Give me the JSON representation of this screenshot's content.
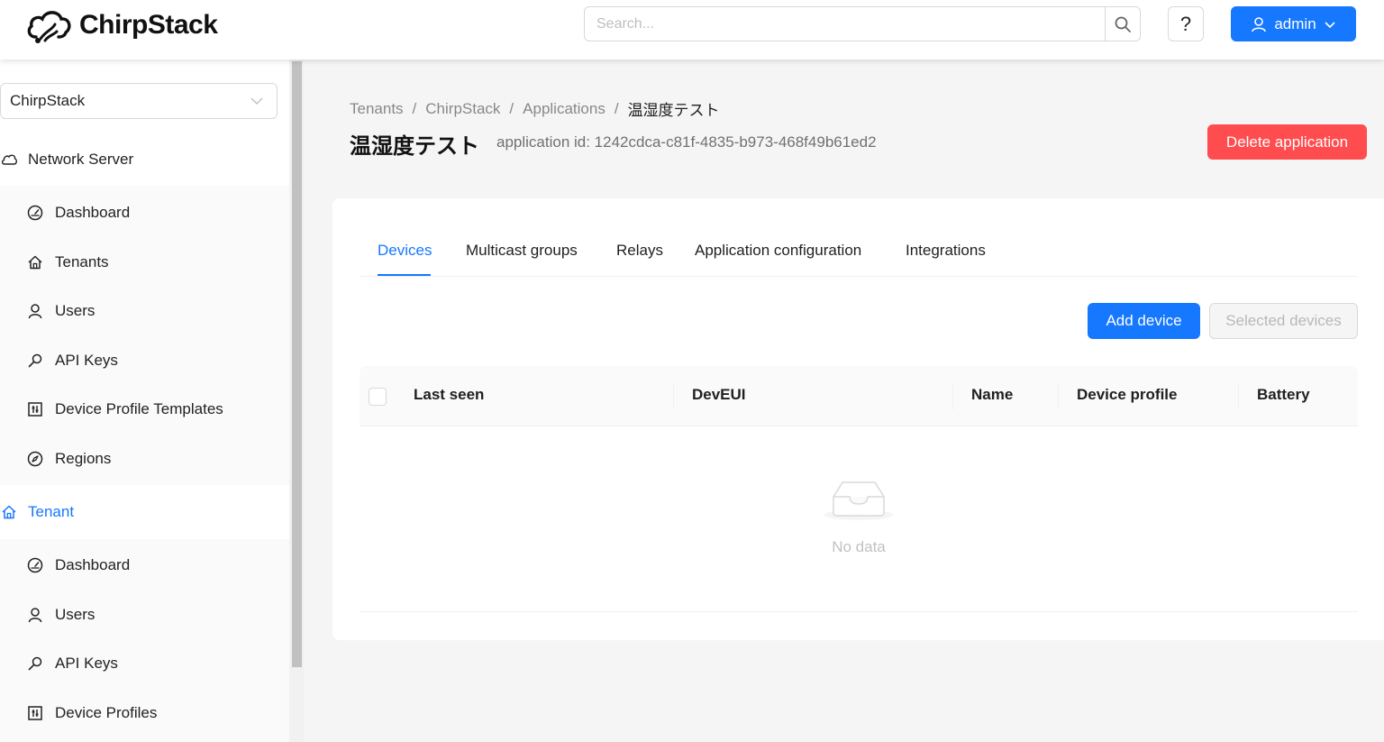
{
  "header": {
    "logo_text": "ChirpStack",
    "search_placeholder": "Search...",
    "help_label": "?",
    "user_label": "admin"
  },
  "sidebar": {
    "tenant_selected": "ChirpStack",
    "network_server": {
      "label": "Network Server",
      "items": [
        {
          "label": "Dashboard",
          "icon": "dashboard-icon"
        },
        {
          "label": "Tenants",
          "icon": "home-icon"
        },
        {
          "label": "Users",
          "icon": "user-icon"
        },
        {
          "label": "API Keys",
          "icon": "key-icon"
        },
        {
          "label": "Device Profile Templates",
          "icon": "template-icon"
        },
        {
          "label": "Regions",
          "icon": "compass-icon"
        }
      ]
    },
    "tenant": {
      "label": "Tenant",
      "items": [
        {
          "label": "Dashboard",
          "icon": "dashboard-icon"
        },
        {
          "label": "Users",
          "icon": "user-icon"
        },
        {
          "label": "API Keys",
          "icon": "key-icon"
        },
        {
          "label": "Device Profiles",
          "icon": "template-icon"
        }
      ]
    }
  },
  "breadcrumb": [
    "Tenants",
    "ChirpStack",
    "Applications",
    "温湿度テスト"
  ],
  "breadcrumb_separator": "/",
  "page": {
    "title": "温湿度テスト",
    "subtitle": "application id: 1242cdca-c81f-4835-b973-468f49b61ed2",
    "delete_label": "Delete application"
  },
  "tabs": [
    {
      "label": "Devices",
      "active": true
    },
    {
      "label": "Multicast groups",
      "active": false
    },
    {
      "label": "Relays",
      "active": false
    },
    {
      "label": "Application configuration",
      "active": false
    },
    {
      "label": "Integrations",
      "active": false
    }
  ],
  "actions": {
    "add_device": "Add device",
    "selected_devices": "Selected devices"
  },
  "table": {
    "columns": [
      "Last seen",
      "DevEUI",
      "Name",
      "Device profile",
      "Battery"
    ],
    "empty_text": "No data"
  },
  "colors": {
    "primary": "#1677ff",
    "danger": "#ff4d4f"
  }
}
